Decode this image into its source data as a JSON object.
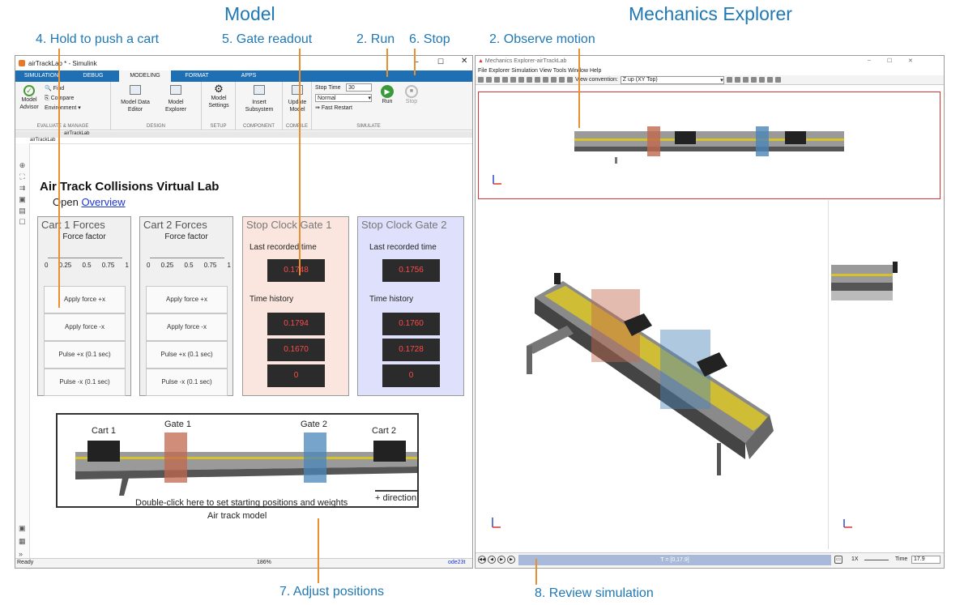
{
  "headers": {
    "model": "Model",
    "mechanics": "Mechanics Explorer"
  },
  "callouts": {
    "c4": "4. Hold to push a cart",
    "c5": "5. Gate readout",
    "c2run": "2. Run",
    "c6": "6. Stop",
    "c2obs": "2. Observe motion",
    "c7": "7. Adjust positions",
    "c8": "8. Review simulation"
  },
  "simulink": {
    "window_title": "airTrackLab * - Simulink",
    "tabs": [
      "SIMULATION",
      "DEBUG",
      "MODELING",
      "FORMAT",
      "APPS"
    ],
    "ribbon": {
      "model_advisor": "Model Advisor",
      "find": "Find",
      "compare": "Compare",
      "environment": "Environment",
      "evaluate_group": "EVALUATE & MANAGE",
      "model_data_editor": "Model Data Editor",
      "model_explorer": "Model Explorer",
      "design_group": "DESIGN",
      "model_settings": "Model Settings",
      "setup_group": "SETUP",
      "insert_subsystem": "Insert Subsystem",
      "component_group": "COMPONENT",
      "update_model": "Update Model",
      "compile_group": "COMPILE",
      "stop_time_label": "Stop Time",
      "stop_time_value": "30",
      "mode": "Normal",
      "fast_restart": "Fast Restart",
      "run": "Run",
      "stop": "Stop",
      "simulate_group": "SIMULATE"
    },
    "breadcrumb_tab": "airTrackLab",
    "address": "airTrackLab",
    "title": "Air Track Collisions Virtual Lab",
    "open_label": "Open",
    "overview_link": "Overview",
    "cart1": {
      "title": "Cart 1 Forces",
      "factor_label": "Force factor",
      "ticks": [
        "0",
        "0.25",
        "0.5",
        "0.75",
        "1"
      ]
    },
    "cart2": {
      "title": "Cart 2 Forces",
      "factor_label": "Force factor",
      "ticks": [
        "0",
        "0.25",
        "0.5",
        "0.75",
        "1"
      ]
    },
    "force_buttons": [
      "Apply force +x",
      "Apply force -x",
      "Pulse +x (0.1 sec)",
      "Pulse -x (0.1 sec)"
    ],
    "gate1": {
      "title": "Stop Clock Gate 1",
      "last_label": "Last recorded time",
      "last": "0.1748",
      "history_label": "Time history",
      "history": [
        "0.1794",
        "0.1670",
        "0"
      ]
    },
    "gate2": {
      "title": "Stop Clock Gate 2",
      "last_label": "Last recorded time",
      "last": "0.1756",
      "history_label": "Time history",
      "history": [
        "0.1760",
        "0.1728",
        "0"
      ]
    },
    "model_image": {
      "cart1": "Cart 1",
      "gate1": "Gate 1",
      "gate2": "Gate 2",
      "cart2": "Cart 2",
      "direction": "+ direction",
      "hint": "Double-click here to set starting positions and weights",
      "caption": "Air track model"
    },
    "status": {
      "ready": "Ready",
      "zoom": "186%",
      "solver": "ode23t"
    }
  },
  "mechanics": {
    "window_title": "Mechanics Explorer-airTrackLab",
    "menu": [
      "File",
      "Explorer",
      "Simulation",
      "View",
      "Tools",
      "Window",
      "Help"
    ],
    "view_convention_label": "View convention:",
    "view_convention": "Z up (XY Top)",
    "time_readout": "T = [0,17.9]",
    "speed": "1X",
    "time_label": "Time",
    "time_value": "17.9"
  },
  "colors": {
    "accent": "#1f78b4",
    "callout_line": "#e8902f",
    "gate1": "#c0684e",
    "gate2": "#4a86b8",
    "display_text": "#ff4a4a"
  }
}
